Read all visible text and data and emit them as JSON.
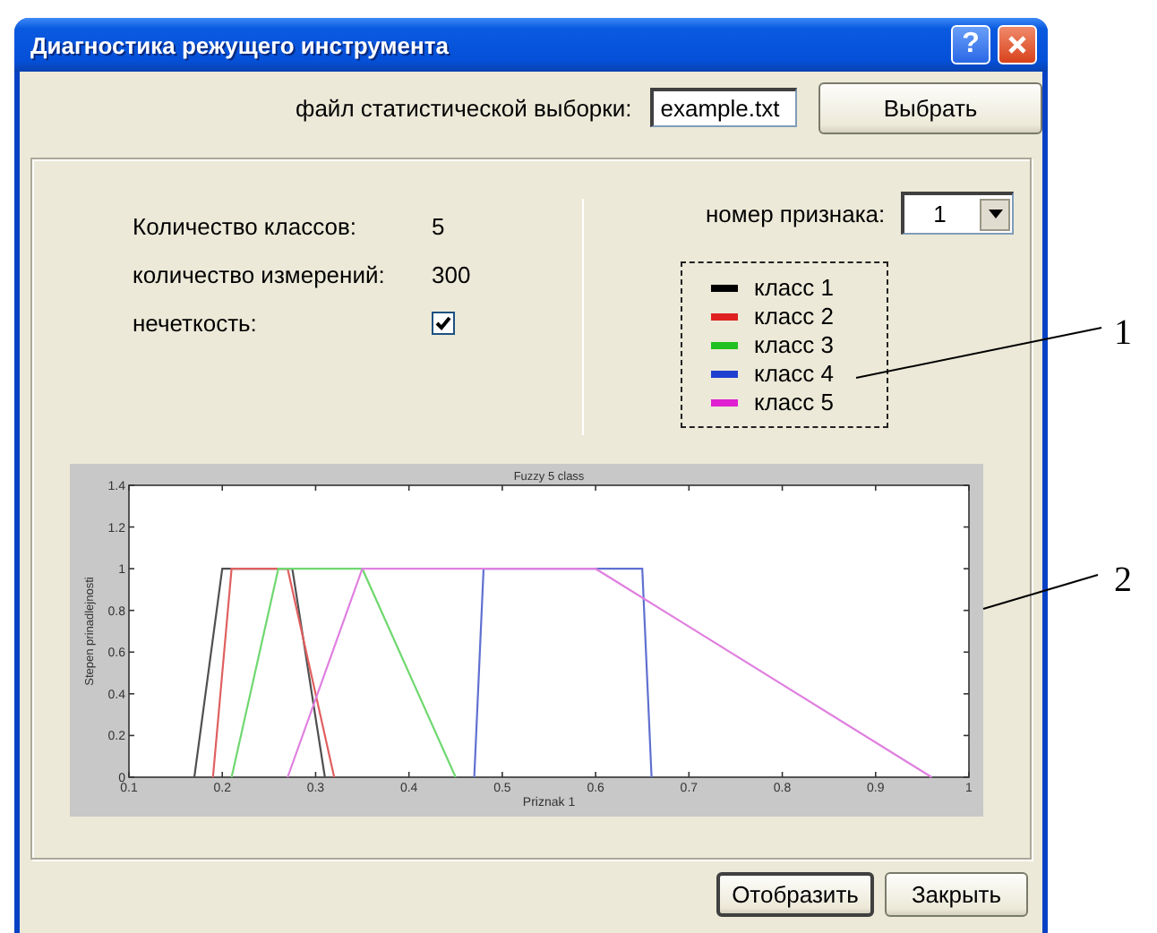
{
  "window": {
    "title": "Диагностика режущего инструмента",
    "help_button": "?"
  },
  "file_row": {
    "label": "файл статистической выборки:",
    "value": "example.txt",
    "button": "Выбрать"
  },
  "stats": [
    {
      "kind": "text",
      "label": "Количество классов:",
      "value": "5"
    },
    {
      "kind": "text",
      "label": "количество измерений:",
      "value": "300"
    },
    {
      "kind": "checkbox",
      "label": "нечеткость:",
      "checked": true
    }
  ],
  "feature": {
    "label": "номер признака:",
    "value": "1"
  },
  "legend": [
    {
      "label": "класс 1",
      "color": "#000000"
    },
    {
      "label": "класс 2",
      "color": "#e02020"
    },
    {
      "label": "класс 3",
      "color": "#20c020"
    },
    {
      "label": "класс 4",
      "color": "#2040d0"
    },
    {
      "label": "класс 5",
      "color": "#e020d0"
    }
  ],
  "chart_data": {
    "type": "line",
    "title": "Fuzzy 5 class",
    "xlabel": "Priznak 1",
    "ylabel": "Stepen prinadlejnosti",
    "xlim": [
      0.1,
      1
    ],
    "ylim": [
      0,
      1.4
    ],
    "xticks": [
      0.1,
      0.2,
      0.3,
      0.4,
      0.5,
      0.6,
      0.7,
      0.8,
      0.9,
      1
    ],
    "yticks": [
      0,
      0.2,
      0.4,
      0.6,
      0.8,
      1,
      1.2,
      1.4
    ],
    "series": [
      {
        "color": "#505050",
        "x": [
          0.17,
          0.2,
          0.275,
          0.31
        ],
        "values": [
          0,
          1,
          1,
          0
        ]
      },
      {
        "color": "#e06060",
        "x": [
          0.19,
          0.21,
          0.27,
          0.32
        ],
        "values": [
          0,
          1,
          1,
          0
        ]
      },
      {
        "color": "#70d870",
        "x": [
          0.21,
          0.26,
          0.35,
          0.45
        ],
        "values": [
          0,
          1,
          1,
          0
        ]
      },
      {
        "color": "#6070d0",
        "x": [
          0.47,
          0.48,
          0.65,
          0.66
        ],
        "values": [
          0,
          1,
          1,
          0
        ]
      },
      {
        "color": "#e080e0",
        "x": [
          0.27,
          0.35,
          0.6,
          0.96
        ],
        "values": [
          0,
          1,
          1,
          0
        ]
      }
    ]
  },
  "buttons": [
    {
      "label": "Отобразить",
      "default": true
    },
    {
      "label": "Закрыть",
      "default": false
    }
  ],
  "callouts": [
    {
      "label": "1"
    },
    {
      "label": "2"
    }
  ]
}
